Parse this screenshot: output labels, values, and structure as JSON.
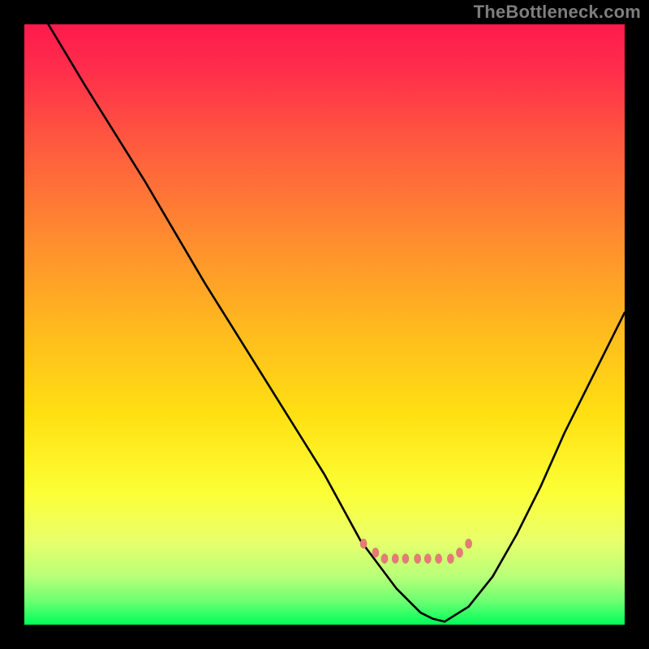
{
  "attribution": "TheBottleneck.com",
  "chart_data": {
    "type": "line",
    "title": "",
    "xlabel": "",
    "ylabel": "",
    "x_range": [
      0,
      100
    ],
    "y_range": [
      0,
      100
    ],
    "series": [
      {
        "name": "bottleneck-curve-left",
        "x": [
          4,
          10,
          20,
          30,
          40,
          50,
          56,
          62,
          66,
          68,
          70
        ],
        "y": [
          100,
          90,
          74,
          57,
          41,
          25,
          14,
          6,
          2,
          1,
          0.5
        ]
      },
      {
        "name": "bottleneck-curve-right",
        "x": [
          70,
          74,
          78,
          82,
          86,
          90,
          94,
          98,
          100
        ],
        "y": [
          0.5,
          3,
          8,
          15,
          23,
          32,
          40,
          48,
          52
        ]
      }
    ],
    "markers": {
      "name": "optimal-range",
      "x": [
        56.5,
        58.5,
        60,
        61.8,
        63.5,
        65.5,
        67.2,
        69,
        71,
        72.5,
        74
      ],
      "y": [
        13.5,
        12,
        11,
        11,
        11,
        11,
        11,
        11,
        11,
        12,
        13.5
      ],
      "rx": 4.2,
      "ry": 6
    },
    "colors": {
      "marker": "#e77a78",
      "curve": "#000000"
    }
  }
}
